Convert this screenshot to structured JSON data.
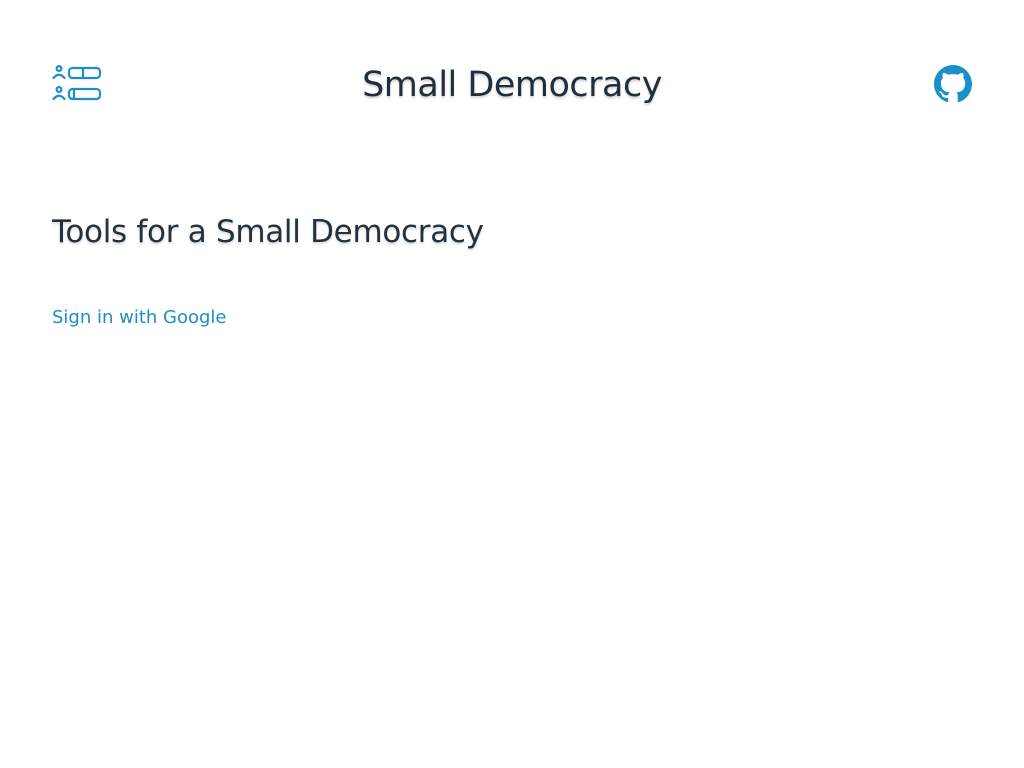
{
  "header": {
    "title": "Small Democracy",
    "logo_icon": "ballot-list-icon",
    "github_icon": "github-icon",
    "accent_color": "#1a8fc9"
  },
  "main": {
    "heading": "Tools for a Small Democracy",
    "signin_label": "Sign in with Google"
  }
}
